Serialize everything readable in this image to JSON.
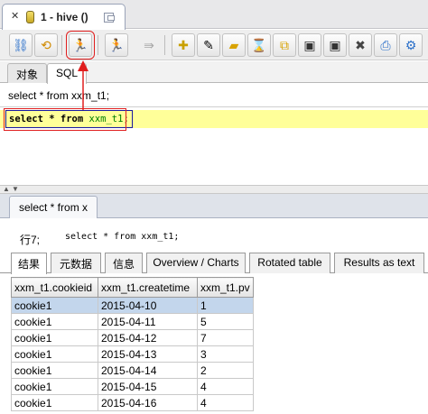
{
  "window_tab": {
    "close": "✕",
    "title": "1 - hive ()"
  },
  "toolbar": {
    "buttons": [
      {
        "name": "connect-button",
        "icon": "connect-icon",
        "glyph": "⛓"
      },
      {
        "name": "refresh-button",
        "icon": "refresh-icon",
        "glyph": "⟲"
      },
      {
        "name": "run-button",
        "icon": "run-icon",
        "glyph": "🏃"
      },
      {
        "name": "stop-button",
        "icon": "stop-icon",
        "glyph": "🏃"
      },
      {
        "name": "step-button",
        "icon": "step-icon",
        "glyph": "⇛"
      },
      {
        "name": "new-button",
        "icon": "new-file-icon",
        "glyph": "🗋"
      },
      {
        "name": "wizard-button",
        "icon": "wand-icon",
        "glyph": "✎"
      },
      {
        "name": "open-button",
        "icon": "folder-icon",
        "glyph": "📂"
      },
      {
        "name": "history-button",
        "icon": "history-icon",
        "glyph": "⌛"
      },
      {
        "name": "copy-button",
        "icon": "copy-icon",
        "glyph": "⧉"
      },
      {
        "name": "save-button",
        "icon": "save-icon",
        "glyph": "💾"
      },
      {
        "name": "save-as-button",
        "icon": "save-as-icon",
        "glyph": "💾"
      },
      {
        "name": "delete-button",
        "icon": "delete-icon",
        "glyph": "✖"
      },
      {
        "name": "export-button",
        "icon": "export-icon",
        "glyph": "⎙"
      },
      {
        "name": "more-button",
        "icon": "tool-icon",
        "glyph": "⚙"
      }
    ]
  },
  "subtabs": {
    "objects": "对象",
    "sql": "SQL"
  },
  "query": {
    "title": "select * from xxm_t1;",
    "code_kw1": "select",
    "code_star": " * ",
    "code_kw2": "from",
    "code_table": " xxm_t1",
    "code_end": ";"
  },
  "result": {
    "tab_label": "select * from x",
    "info_label": "行7;",
    "info_query": "select * from xxm_t1;",
    "inner_tabs": [
      "结果",
      "元数据",
      "信息",
      "Overview / Charts",
      "Rotated table",
      "Results as text"
    ],
    "columns": [
      "xxm_t1.cookieid",
      "xxm_t1.createtime",
      "xxm_t1.pv"
    ],
    "rows": [
      [
        "cookie1",
        "2015-04-10",
        "1"
      ],
      [
        "cookie1",
        "2015-04-11",
        "5"
      ],
      [
        "cookie1",
        "2015-04-12",
        "7"
      ],
      [
        "cookie1",
        "2015-04-13",
        "3"
      ],
      [
        "cookie1",
        "2015-04-14",
        "2"
      ],
      [
        "cookie1",
        "2015-04-15",
        "4"
      ],
      [
        "cookie1",
        "2015-04-16",
        "4"
      ]
    ]
  },
  "colors": {
    "annotation": "#e01e1e",
    "selection": "#c3d6ec",
    "editor_line": "#ffff99"
  }
}
